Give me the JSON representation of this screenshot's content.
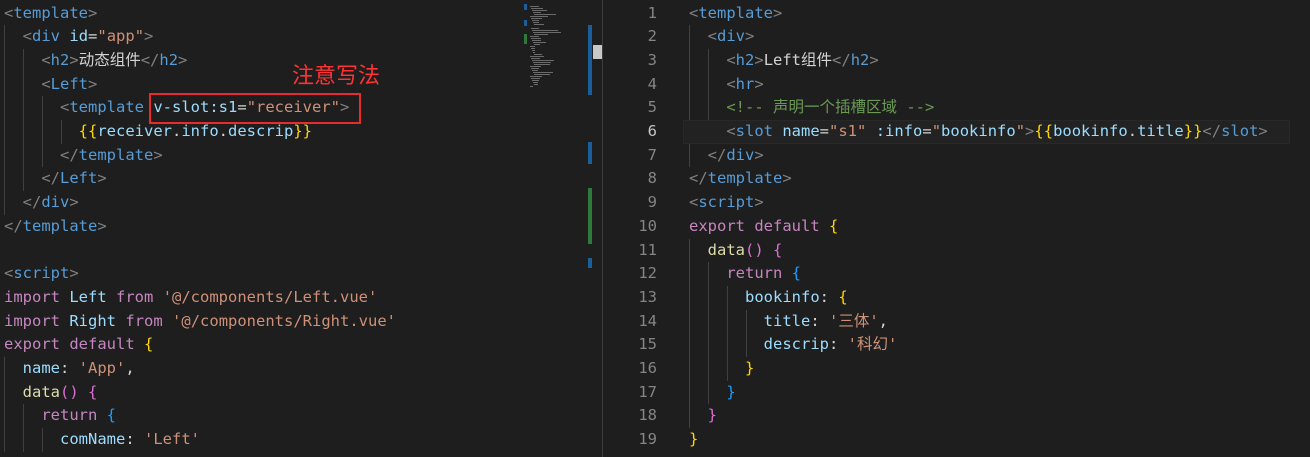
{
  "annotation": {
    "text": "注意写法",
    "color": "#e82c2c"
  },
  "left": {
    "lines": [
      [
        {
          "c": "t",
          "v": "<"
        },
        {
          "c": "tag",
          "v": "template"
        },
        {
          "c": "t",
          "v": ">"
        }
      ],
      [
        {
          "c": "txt",
          "v": "  "
        },
        {
          "c": "t",
          "v": "<"
        },
        {
          "c": "tag",
          "v": "div"
        },
        {
          "c": "txt",
          "v": " "
        },
        {
          "c": "attr",
          "v": "id"
        },
        {
          "c": "txt",
          "v": "="
        },
        {
          "c": "str",
          "v": "\"app\""
        },
        {
          "c": "t",
          "v": ">"
        }
      ],
      [
        {
          "c": "txt",
          "v": "    "
        },
        {
          "c": "t",
          "v": "<"
        },
        {
          "c": "tag",
          "v": "h2"
        },
        {
          "c": "t",
          "v": ">"
        },
        {
          "c": "txt",
          "v": "动态组件"
        },
        {
          "c": "t",
          "v": "</"
        },
        {
          "c": "tag",
          "v": "h2"
        },
        {
          "c": "t",
          "v": ">"
        }
      ],
      [
        {
          "c": "txt",
          "v": "    "
        },
        {
          "c": "t",
          "v": "<"
        },
        {
          "c": "tag",
          "v": "Left"
        },
        {
          "c": "t",
          "v": ">"
        }
      ],
      [
        {
          "c": "txt",
          "v": "      "
        },
        {
          "c": "t",
          "v": "<"
        },
        {
          "c": "tag",
          "v": "template"
        },
        {
          "c": "txt",
          "v": " "
        },
        {
          "c": "attr",
          "v": "v-slot:s1"
        },
        {
          "c": "txt",
          "v": "="
        },
        {
          "c": "str",
          "v": "\"receiver\""
        },
        {
          "c": "t",
          "v": ">"
        }
      ],
      [
        {
          "c": "txt",
          "v": "        "
        },
        {
          "c": "br1",
          "v": "{{"
        },
        {
          "c": "attr",
          "v": "receiver"
        },
        {
          "c": "txt",
          "v": "."
        },
        {
          "c": "attr",
          "v": "info"
        },
        {
          "c": "txt",
          "v": "."
        },
        {
          "c": "attr",
          "v": "descrip"
        },
        {
          "c": "br1",
          "v": "}}"
        }
      ],
      [
        {
          "c": "txt",
          "v": "      "
        },
        {
          "c": "t",
          "v": "</"
        },
        {
          "c": "tag",
          "v": "template"
        },
        {
          "c": "t",
          "v": ">"
        }
      ],
      [
        {
          "c": "txt",
          "v": "    "
        },
        {
          "c": "t",
          "v": "</"
        },
        {
          "c": "tag",
          "v": "Left"
        },
        {
          "c": "t",
          "v": ">"
        }
      ],
      [
        {
          "c": "txt",
          "v": "  "
        },
        {
          "c": "t",
          "v": "</"
        },
        {
          "c": "tag",
          "v": "div"
        },
        {
          "c": "t",
          "v": ">"
        }
      ],
      [
        {
          "c": "t",
          "v": "</"
        },
        {
          "c": "tag",
          "v": "template"
        },
        {
          "c": "t",
          "v": ">"
        }
      ],
      [],
      [
        {
          "c": "t",
          "v": "<"
        },
        {
          "c": "tag",
          "v": "script"
        },
        {
          "c": "t",
          "v": ">"
        }
      ],
      [
        {
          "c": "kw",
          "v": "import"
        },
        {
          "c": "txt",
          "v": " "
        },
        {
          "c": "attr",
          "v": "Left"
        },
        {
          "c": "txt",
          "v": " "
        },
        {
          "c": "kw",
          "v": "from"
        },
        {
          "c": "txt",
          "v": " "
        },
        {
          "c": "str",
          "v": "'@/components/Left.vue'"
        }
      ],
      [
        {
          "c": "kw",
          "v": "import"
        },
        {
          "c": "txt",
          "v": " "
        },
        {
          "c": "attr",
          "v": "Right"
        },
        {
          "c": "txt",
          "v": " "
        },
        {
          "c": "kw",
          "v": "from"
        },
        {
          "c": "txt",
          "v": " "
        },
        {
          "c": "str",
          "v": "'@/components/Right.vue'"
        }
      ],
      [
        {
          "c": "kw",
          "v": "export"
        },
        {
          "c": "txt",
          "v": " "
        },
        {
          "c": "kw",
          "v": "default"
        },
        {
          "c": "txt",
          "v": " "
        },
        {
          "c": "br1",
          "v": "{"
        }
      ],
      [
        {
          "c": "txt",
          "v": "  "
        },
        {
          "c": "prop",
          "v": "name"
        },
        {
          "c": "txt",
          "v": ": "
        },
        {
          "c": "str",
          "v": "'App'"
        },
        {
          "c": "txt",
          "v": ","
        }
      ],
      [
        {
          "c": "txt",
          "v": "  "
        },
        {
          "c": "fn",
          "v": "data"
        },
        {
          "c": "br2",
          "v": "()"
        },
        {
          "c": "txt",
          "v": " "
        },
        {
          "c": "br2",
          "v": "{"
        }
      ],
      [
        {
          "c": "txt",
          "v": "    "
        },
        {
          "c": "kw",
          "v": "return"
        },
        {
          "c": "txt",
          "v": " "
        },
        {
          "c": "br3",
          "v": "{"
        }
      ],
      [
        {
          "c": "txt",
          "v": "      "
        },
        {
          "c": "prop",
          "v": "comName"
        },
        {
          "c": "txt",
          "v": ": "
        },
        {
          "c": "str",
          "v": "'Left'"
        }
      ]
    ]
  },
  "right": {
    "active_line": 6,
    "line_numbers": [
      "1",
      "2",
      "3",
      "4",
      "5",
      "6",
      "7",
      "8",
      "9",
      "10",
      "11",
      "12",
      "13",
      "14",
      "15",
      "16",
      "17",
      "18",
      "19"
    ],
    "lines": [
      [
        {
          "c": "t",
          "v": "<"
        },
        {
          "c": "tag",
          "v": "template"
        },
        {
          "c": "t",
          "v": ">"
        }
      ],
      [
        {
          "c": "txt",
          "v": "  "
        },
        {
          "c": "t",
          "v": "<"
        },
        {
          "c": "tag",
          "v": "div"
        },
        {
          "c": "t",
          "v": ">"
        }
      ],
      [
        {
          "c": "txt",
          "v": "    "
        },
        {
          "c": "t",
          "v": "<"
        },
        {
          "c": "tag",
          "v": "h2"
        },
        {
          "c": "t",
          "v": ">"
        },
        {
          "c": "txt",
          "v": "Left组件"
        },
        {
          "c": "t",
          "v": "</"
        },
        {
          "c": "tag",
          "v": "h2"
        },
        {
          "c": "t",
          "v": ">"
        }
      ],
      [
        {
          "c": "txt",
          "v": "    "
        },
        {
          "c": "t",
          "v": "<"
        },
        {
          "c": "tag",
          "v": "hr"
        },
        {
          "c": "t",
          "v": ">"
        }
      ],
      [
        {
          "c": "txt",
          "v": "    "
        },
        {
          "c": "cm",
          "v": "<!-- 声明一个插槽区域 -->"
        }
      ],
      [
        {
          "c": "txt",
          "v": "    "
        },
        {
          "c": "t",
          "v": "<"
        },
        {
          "c": "tag",
          "v": "slot"
        },
        {
          "c": "txt",
          "v": " "
        },
        {
          "c": "attr",
          "v": "name"
        },
        {
          "c": "txt",
          "v": "="
        },
        {
          "c": "str",
          "v": "\"s1\""
        },
        {
          "c": "txt",
          "v": " "
        },
        {
          "c": "attr",
          "v": ":info"
        },
        {
          "c": "txt",
          "v": "="
        },
        {
          "c": "str",
          "v": "\""
        },
        {
          "c": "attr",
          "v": "bookinfo"
        },
        {
          "c": "str",
          "v": "\""
        },
        {
          "c": "t",
          "v": ">"
        },
        {
          "c": "br1",
          "v": "{{"
        },
        {
          "c": "attr",
          "v": "bookinfo"
        },
        {
          "c": "txt",
          "v": "."
        },
        {
          "c": "attr",
          "v": "title"
        },
        {
          "c": "br1",
          "v": "}}"
        },
        {
          "c": "t",
          "v": "</"
        },
        {
          "c": "tag",
          "v": "slot"
        },
        {
          "c": "t",
          "v": ">"
        }
      ],
      [
        {
          "c": "txt",
          "v": "  "
        },
        {
          "c": "t",
          "v": "</"
        },
        {
          "c": "tag",
          "v": "div"
        },
        {
          "c": "t",
          "v": ">"
        }
      ],
      [
        {
          "c": "t",
          "v": "</"
        },
        {
          "c": "tag",
          "v": "template"
        },
        {
          "c": "t",
          "v": ">"
        }
      ],
      [
        {
          "c": "t",
          "v": "<"
        },
        {
          "c": "tag",
          "v": "script"
        },
        {
          "c": "t",
          "v": ">"
        }
      ],
      [
        {
          "c": "kw",
          "v": "export"
        },
        {
          "c": "txt",
          "v": " "
        },
        {
          "c": "kw",
          "v": "default"
        },
        {
          "c": "txt",
          "v": " "
        },
        {
          "c": "br1",
          "v": "{"
        }
      ],
      [
        {
          "c": "txt",
          "v": "  "
        },
        {
          "c": "fn",
          "v": "data"
        },
        {
          "c": "br2",
          "v": "()"
        },
        {
          "c": "txt",
          "v": " "
        },
        {
          "c": "br2",
          "v": "{"
        }
      ],
      [
        {
          "c": "txt",
          "v": "    "
        },
        {
          "c": "kw",
          "v": "return"
        },
        {
          "c": "txt",
          "v": " "
        },
        {
          "c": "br3",
          "v": "{"
        }
      ],
      [
        {
          "c": "txt",
          "v": "      "
        },
        {
          "c": "prop",
          "v": "bookinfo"
        },
        {
          "c": "txt",
          "v": ": "
        },
        {
          "c": "br1",
          "v": "{"
        }
      ],
      [
        {
          "c": "txt",
          "v": "        "
        },
        {
          "c": "prop",
          "v": "title"
        },
        {
          "c": "txt",
          "v": ": "
        },
        {
          "c": "str",
          "v": "'三体'"
        },
        {
          "c": "txt",
          "v": ","
        }
      ],
      [
        {
          "c": "txt",
          "v": "        "
        },
        {
          "c": "prop",
          "v": "descrip"
        },
        {
          "c": "txt",
          "v": ": "
        },
        {
          "c": "str",
          "v": "'科幻'"
        }
      ],
      [
        {
          "c": "txt",
          "v": "      "
        },
        {
          "c": "br1",
          "v": "}"
        }
      ],
      [
        {
          "c": "txt",
          "v": "    "
        },
        {
          "c": "br3",
          "v": "}"
        }
      ],
      [
        {
          "c": "txt",
          "v": "  "
        },
        {
          "c": "br2",
          "v": "}"
        }
      ],
      [
        {
          "c": "br1",
          "v": "}"
        }
      ]
    ]
  }
}
